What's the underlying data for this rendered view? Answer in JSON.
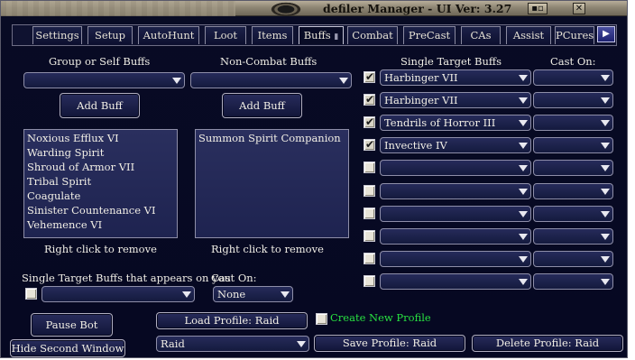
{
  "window": {
    "title": "defiler Manager  - UI Ver: 3.27",
    "controls": [
      "minimize-icon",
      "close-icon"
    ]
  },
  "tabs": [
    "Settings",
    "Setup",
    "AutoHunt",
    "Loot",
    "Items",
    "Buffs",
    "Combat",
    "PreCast",
    "CAs",
    "Assist",
    "PCures"
  ],
  "tabs_active": "Buffs",
  "group_buffs": {
    "header": "Group or Self Buffs",
    "combo_value": "",
    "add_label": "Add Buff",
    "items": [
      "Noxious Efflux VI",
      "Warding Spirit",
      "Shroud of Armor VII",
      "Tribal Spirit",
      "Coagulate",
      "Sinister Countenance VI",
      "Vehemence VI"
    ],
    "hint": "Right click to remove"
  },
  "noncombat_buffs": {
    "header": "Non-Combat Buffs",
    "combo_value": "",
    "add_label": "Add Buff",
    "items": [
      "Summon Spirit Companion"
    ],
    "hint": "Right click to remove"
  },
  "single_target": {
    "header": "Single Target Buffs",
    "cast_on_header": "Cast On:",
    "rows": [
      {
        "checked": true,
        "buff": "Harbinger VII",
        "target": ""
      },
      {
        "checked": true,
        "buff": "Harbinger VII",
        "target": ""
      },
      {
        "checked": true,
        "buff": "Tendrils of Horror III",
        "target": ""
      },
      {
        "checked": true,
        "buff": "Invective IV",
        "target": ""
      },
      {
        "checked": false,
        "buff": "",
        "target": ""
      },
      {
        "checked": false,
        "buff": "",
        "target": ""
      },
      {
        "checked": false,
        "buff": "",
        "target": ""
      },
      {
        "checked": false,
        "buff": "",
        "target": ""
      },
      {
        "checked": false,
        "buff": "",
        "target": ""
      },
      {
        "checked": false,
        "buff": "",
        "target": ""
      }
    ]
  },
  "appears_on_you": {
    "label": "Single Target Buffs that appears on you",
    "checked": false,
    "combo_value": "",
    "cast_on_label": "Cast On:",
    "cast_on_value": "None"
  },
  "bottom": {
    "pause_label": "Pause Bot",
    "hide_label": "Hide Second Window",
    "load_profile_label": "Load Profile: Raid",
    "create_profile_label": "Create New Profile",
    "create_profile_checked": false,
    "profile_combo": "Raid",
    "save_profile_label": "Save Profile: Raid",
    "delete_profile_label": "Delete Profile: Raid"
  },
  "colors": {
    "background": "#070a24",
    "create_profile_text": "#28e040",
    "title_bar": "#a39a86"
  }
}
